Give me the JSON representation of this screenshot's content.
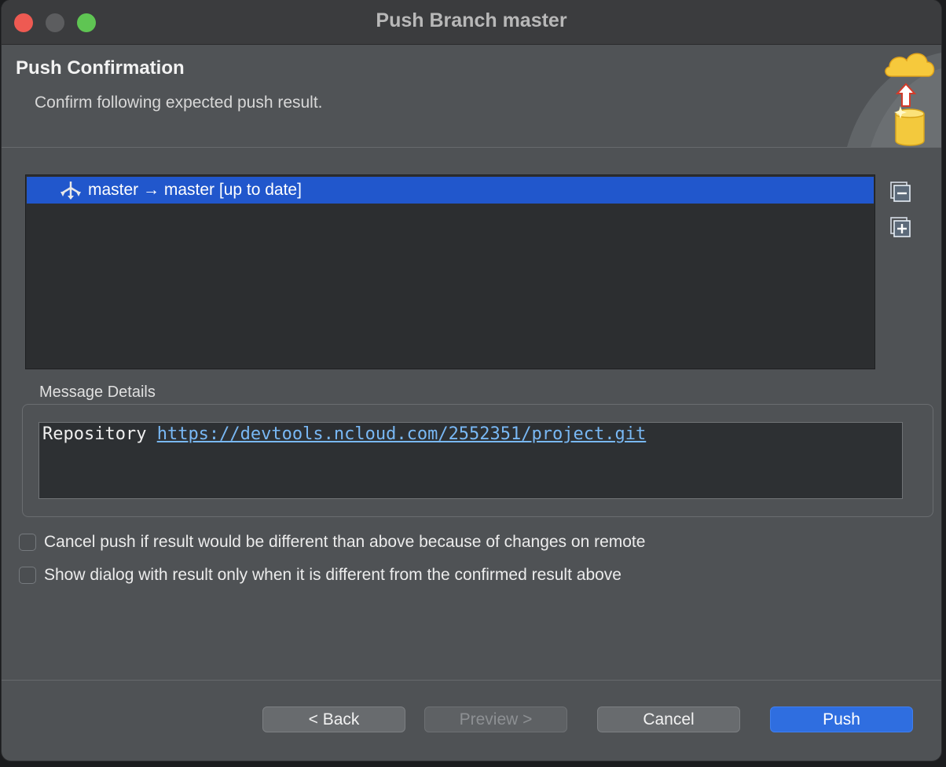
{
  "window": {
    "title": "Push Branch master"
  },
  "header": {
    "title": "Push Confirmation",
    "subtitle": "Confirm following expected push result."
  },
  "tree": {
    "rows": [
      {
        "label": "master → master [up to date]",
        "icon": "branch-icon",
        "selected": true
      }
    ],
    "collapse_icon": "collapse-all-icon",
    "expand_icon": "expand-all-icon"
  },
  "message_details": {
    "label": "Message Details",
    "repository_label": "Repository",
    "repository_url": "https://devtools.ncloud.com/2552351/project.git"
  },
  "options": [
    {
      "label": "Cancel push if result would be different than above because of changes on remote",
      "checked": false
    },
    {
      "label": "Show dialog with result only when it is different from the confirmed result above",
      "checked": false
    }
  ],
  "buttons": {
    "back": "< Back",
    "preview": "Preview >",
    "cancel": "Cancel",
    "push": "Push"
  },
  "colors": {
    "selection": "#2157cc",
    "primary_button": "#2f6ee0",
    "link": "#79b8f4"
  }
}
